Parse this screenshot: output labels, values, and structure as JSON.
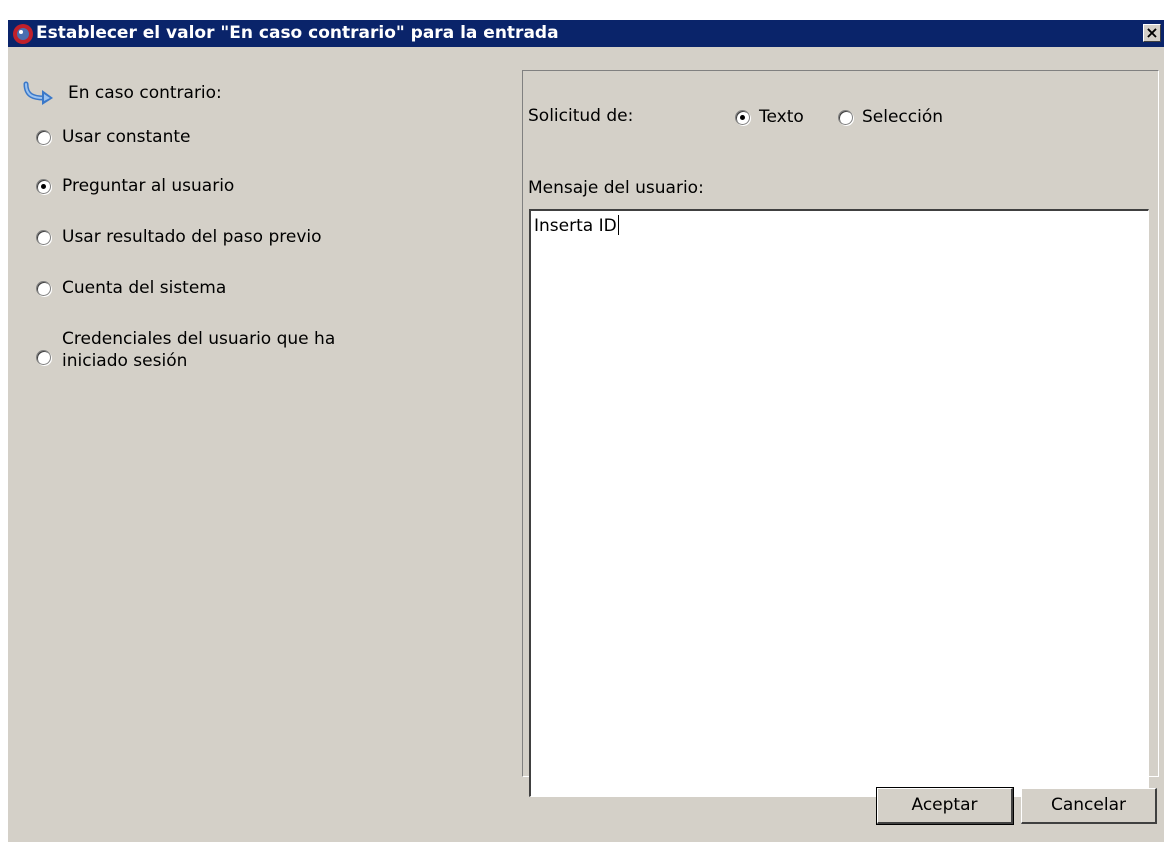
{
  "window": {
    "title": "Establecer el valor \"En caso contrario\" para la entrada",
    "close_glyph": "×",
    "title_icon": "app-bug-icon",
    "colors": {
      "titlebar": "#0a246a",
      "face": "#d4d0c8"
    }
  },
  "otherwise": {
    "header_label": "En caso contrario:",
    "header_icon": "curved-arrow-icon",
    "options": [
      {
        "label": "Usar constante",
        "selected": false
      },
      {
        "label": "Preguntar al usuario",
        "selected": true
      },
      {
        "label": "Usar resultado del paso previo",
        "selected": false
      },
      {
        "label": "Cuenta del sistema",
        "selected": false
      },
      {
        "label": "Credenciales del usuario que ha iniciado sesión",
        "selected": false
      }
    ]
  },
  "request": {
    "label": "Solicitud de:",
    "options": [
      {
        "label": "Texto",
        "selected": true
      },
      {
        "label": "Selección",
        "selected": false
      }
    ]
  },
  "message": {
    "label": "Mensaje del usuario:",
    "value": "Inserta ID"
  },
  "buttons": {
    "ok_label": "Aceptar",
    "cancel_label": "Cancelar"
  }
}
